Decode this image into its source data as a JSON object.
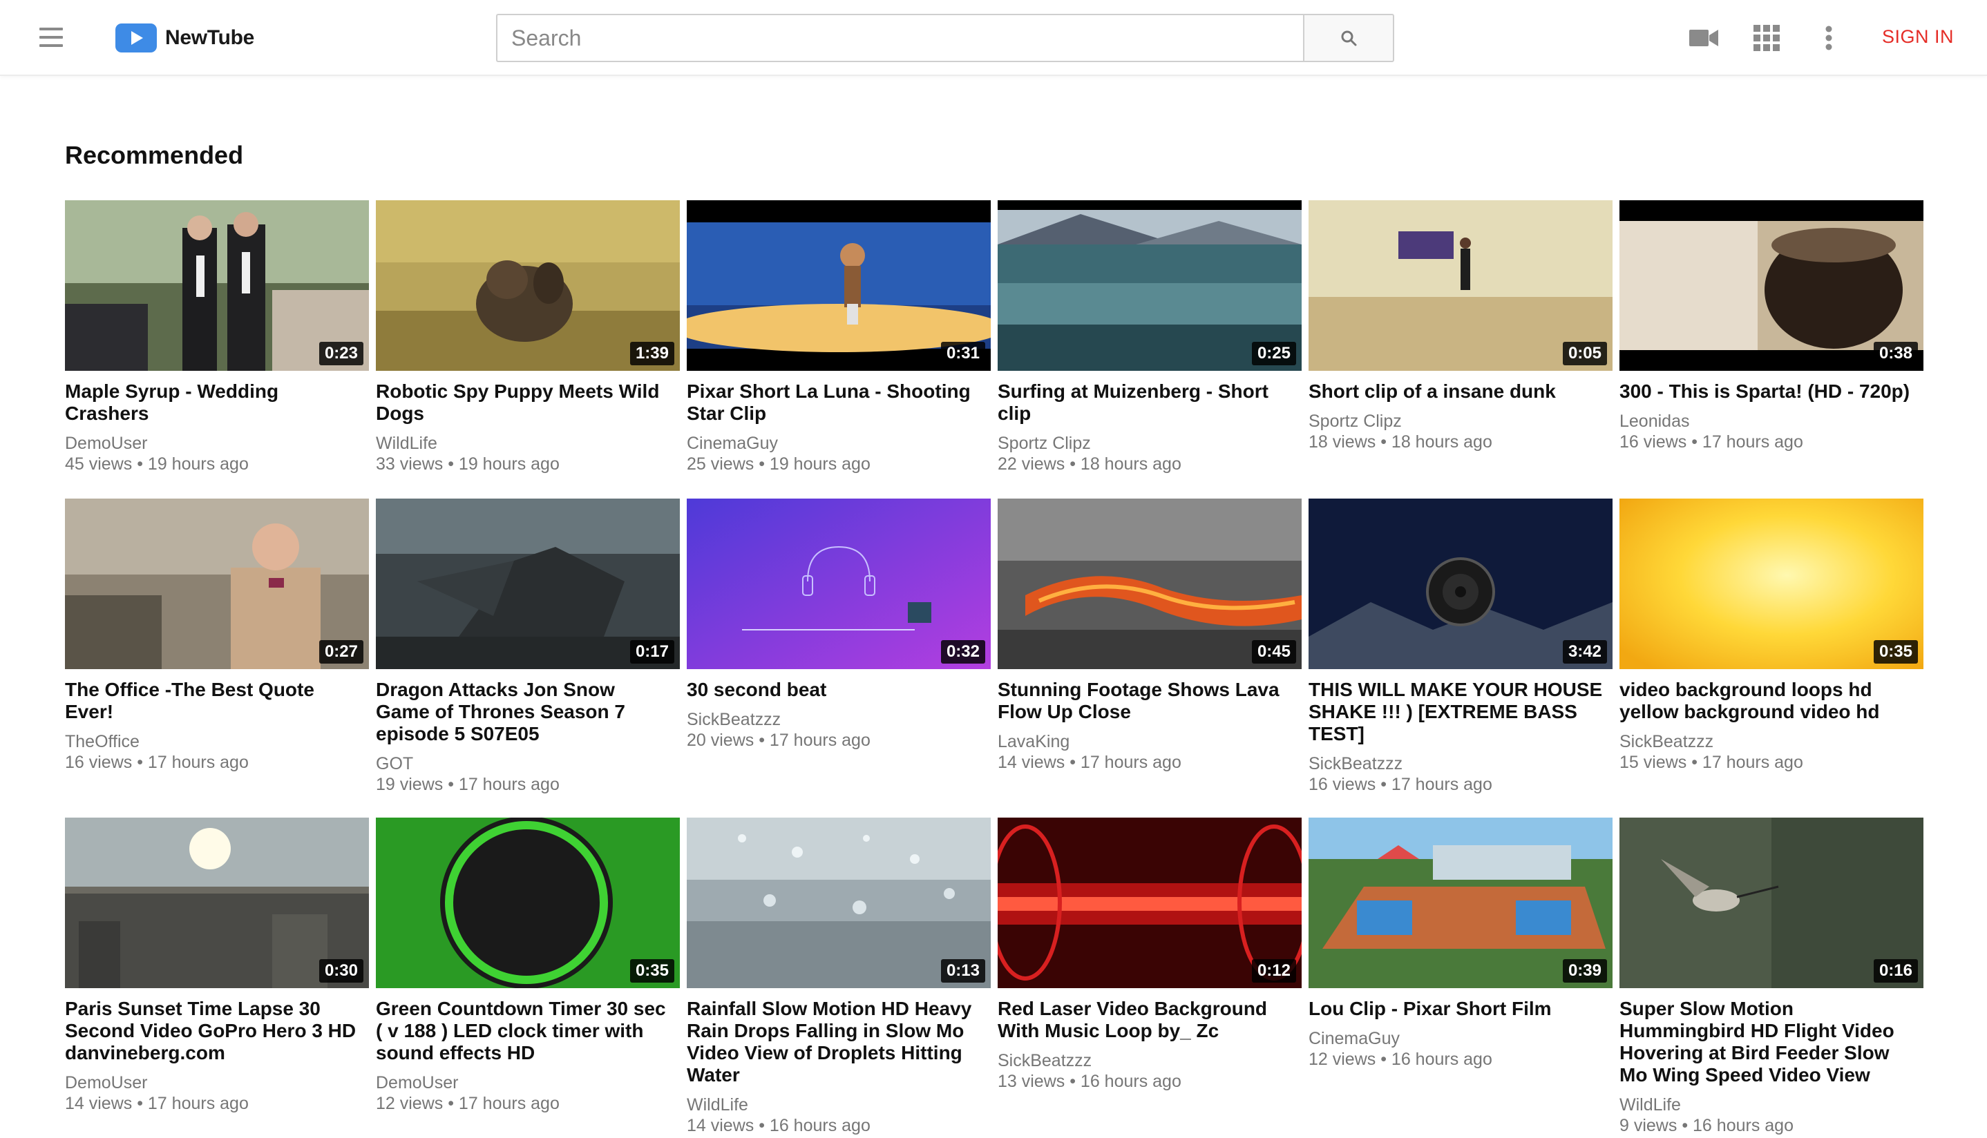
{
  "app": {
    "name": "NewTube",
    "icon": "play-logo-icon"
  },
  "header": {
    "menu_icon": "hamburger-menu-icon",
    "search_placeholder": "Search",
    "search_icon": "search-icon",
    "upload_icon": "video-camera-icon",
    "apps_icon": "apps-grid-icon",
    "more_icon": "more-vertical-icon",
    "sign_in": "SIGN IN"
  },
  "colors": {
    "brand_blue": "#3e8be6",
    "sign_in_red": "#e52d27"
  },
  "section": {
    "title": "Recommended"
  },
  "videos": [
    {
      "title": "Maple Syrup - Wedding Crashers",
      "channel": "DemoUser",
      "views": "45 views",
      "age": "19 hours ago",
      "duration": "0:23"
    },
    {
      "title": "Robotic Spy Puppy Meets Wild Dogs",
      "channel": "WildLife",
      "views": "33 views",
      "age": "19 hours ago",
      "duration": "1:39"
    },
    {
      "title": "Pixar Short La Luna - Shooting Star Clip",
      "channel": "CinemaGuy",
      "views": "25 views",
      "age": "19 hours ago",
      "duration": "0:31"
    },
    {
      "title": "Surfing at Muizenberg - Short clip",
      "channel": "Sportz Clipz",
      "views": "22 views",
      "age": "18 hours ago",
      "duration": "0:25"
    },
    {
      "title": "Short clip of a insane dunk",
      "channel": "Sportz Clipz",
      "views": "18 views",
      "age": "18 hours ago",
      "duration": "0:05"
    },
    {
      "title": "300 - This is Sparta! (HD - 720p)",
      "channel": "Leonidas",
      "views": "16 views",
      "age": "17 hours ago",
      "duration": "0:38"
    },
    {
      "title": "The Office -The Best Quote Ever!",
      "channel": "TheOffice",
      "views": "16 views",
      "age": "17 hours ago",
      "duration": "0:27"
    },
    {
      "title": "Dragon Attacks Jon Snow Game of Thrones Season 7 episode 5 S07E05",
      "channel": "GOT",
      "views": "19 views",
      "age": "17 hours ago",
      "duration": "0:17"
    },
    {
      "title": "30 second beat",
      "channel": "SickBeatzzz",
      "views": "20 views",
      "age": "17 hours ago",
      "duration": "0:32"
    },
    {
      "title": "Stunning Footage Shows Lava Flow Up Close",
      "channel": "LavaKing",
      "views": "14 views",
      "age": "17 hours ago",
      "duration": "0:45"
    },
    {
      "title": "THIS WILL MAKE YOUR HOUSE SHAKE !!! ) [EXTREME BASS TEST]",
      "channel": "SickBeatzzz",
      "views": "16 views",
      "age": "17 hours ago",
      "duration": "3:42"
    },
    {
      "title": "video background loops hd yellow background video hd",
      "channel": "SickBeatzzz",
      "views": "15 views",
      "age": "17 hours ago",
      "duration": "0:35"
    },
    {
      "title": "Paris Sunset Time Lapse 30 Second Video GoPro Hero 3 HD danvineberg.com",
      "channel": "DemoUser",
      "views": "14 views",
      "age": "17 hours ago",
      "duration": "0:30"
    },
    {
      "title": "Green Countdown Timer 30 sec ( v 188 ) LED clock timer with sound effects HD",
      "channel": "DemoUser",
      "views": "12 views",
      "age": "17 hours ago",
      "duration": "0:35"
    },
    {
      "title": "Rainfall Slow Motion HD Heavy Rain Drops Falling in Slow Mo Video View of Droplets Hitting Water",
      "channel": "WildLife",
      "views": "14 views",
      "age": "16 hours ago",
      "duration": "0:13"
    },
    {
      "title": "Red Laser Video Background With Music Loop by_ Zc",
      "channel": "SickBeatzzz",
      "views": "13 views",
      "age": "16 hours ago",
      "duration": "0:12"
    },
    {
      "title": "Lou Clip - Pixar Short Film",
      "channel": "CinemaGuy",
      "views": "12 views",
      "age": "16 hours ago",
      "duration": "0:39"
    },
    {
      "title": "Super Slow Motion Hummingbird HD Flight Video Hovering at Bird Feeder Slow Mo Wing Speed Video View",
      "channel": "WildLife",
      "views": "9 views",
      "age": "16 hours ago",
      "duration": "0:16"
    }
  ]
}
